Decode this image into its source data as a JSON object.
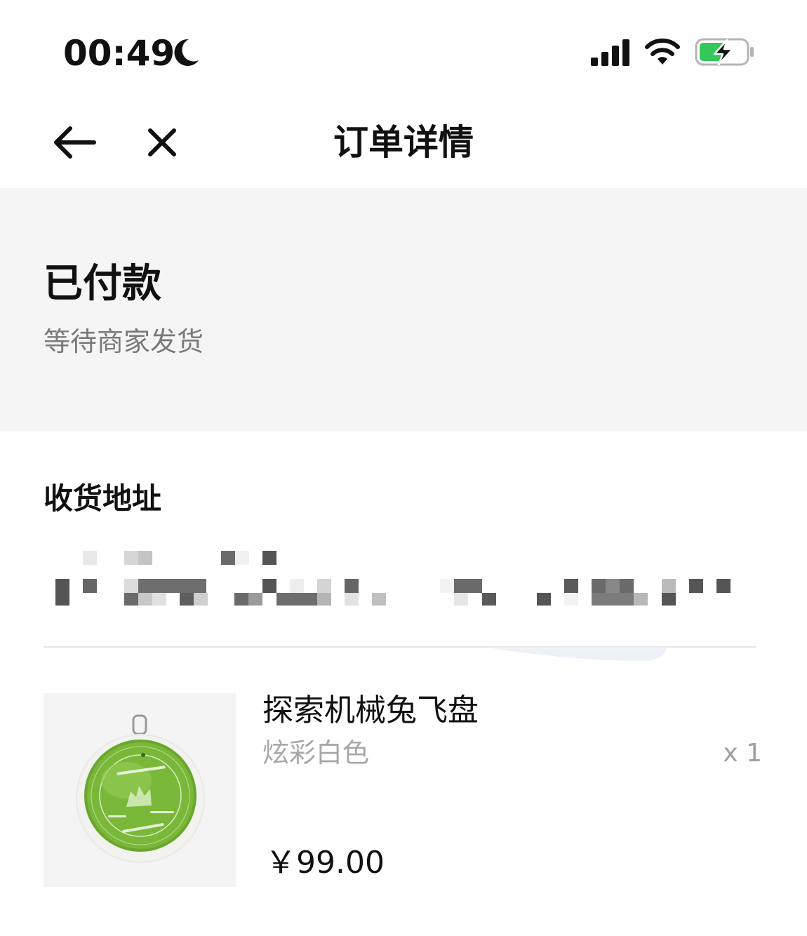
{
  "status_bar": {
    "time": "00:49",
    "focus_icon": "moon-icon",
    "signal_icon": "cellular-signal-icon",
    "wifi_icon": "wifi-icon",
    "battery_icon": "battery-charging-icon",
    "battery_color": "#34c759"
  },
  "nav": {
    "back_icon": "arrow-left-icon",
    "close_icon": "close-icon",
    "title": "订单详情"
  },
  "order_status": {
    "title": "已付款",
    "subtitle": "等待商家发货",
    "background": "#f5f5f5"
  },
  "address": {
    "section_title": "收货地址",
    "content_obscured": true
  },
  "product": {
    "name": "探索机械兔飞盘",
    "variant": "炫彩白色",
    "quantity": "x 1",
    "price": "￥99.00",
    "image_icon": "green-frisbee-image"
  }
}
